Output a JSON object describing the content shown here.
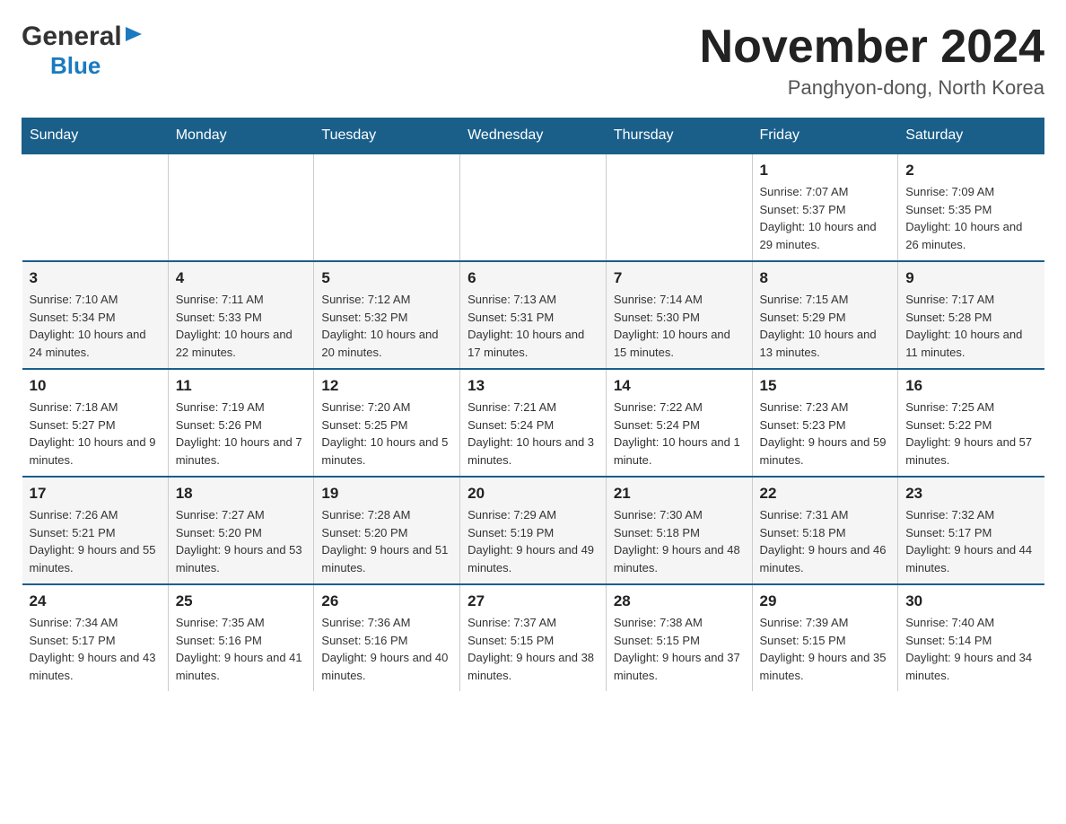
{
  "header": {
    "logo": {
      "general": "General",
      "blue": "Blue"
    },
    "title": "November 2024",
    "location": "Panghyon-dong, North Korea"
  },
  "days_of_week": [
    "Sunday",
    "Monday",
    "Tuesday",
    "Wednesday",
    "Thursday",
    "Friday",
    "Saturday"
  ],
  "weeks": [
    {
      "days": [
        {
          "number": "",
          "info": ""
        },
        {
          "number": "",
          "info": ""
        },
        {
          "number": "",
          "info": ""
        },
        {
          "number": "",
          "info": ""
        },
        {
          "number": "",
          "info": ""
        },
        {
          "number": "1",
          "info": "Sunrise: 7:07 AM\nSunset: 5:37 PM\nDaylight: 10 hours and 29 minutes."
        },
        {
          "number": "2",
          "info": "Sunrise: 7:09 AM\nSunset: 5:35 PM\nDaylight: 10 hours and 26 minutes."
        }
      ]
    },
    {
      "days": [
        {
          "number": "3",
          "info": "Sunrise: 7:10 AM\nSunset: 5:34 PM\nDaylight: 10 hours and 24 minutes."
        },
        {
          "number": "4",
          "info": "Sunrise: 7:11 AM\nSunset: 5:33 PM\nDaylight: 10 hours and 22 minutes."
        },
        {
          "number": "5",
          "info": "Sunrise: 7:12 AM\nSunset: 5:32 PM\nDaylight: 10 hours and 20 minutes."
        },
        {
          "number": "6",
          "info": "Sunrise: 7:13 AM\nSunset: 5:31 PM\nDaylight: 10 hours and 17 minutes."
        },
        {
          "number": "7",
          "info": "Sunrise: 7:14 AM\nSunset: 5:30 PM\nDaylight: 10 hours and 15 minutes."
        },
        {
          "number": "8",
          "info": "Sunrise: 7:15 AM\nSunset: 5:29 PM\nDaylight: 10 hours and 13 minutes."
        },
        {
          "number": "9",
          "info": "Sunrise: 7:17 AM\nSunset: 5:28 PM\nDaylight: 10 hours and 11 minutes."
        }
      ]
    },
    {
      "days": [
        {
          "number": "10",
          "info": "Sunrise: 7:18 AM\nSunset: 5:27 PM\nDaylight: 10 hours and 9 minutes."
        },
        {
          "number": "11",
          "info": "Sunrise: 7:19 AM\nSunset: 5:26 PM\nDaylight: 10 hours and 7 minutes."
        },
        {
          "number": "12",
          "info": "Sunrise: 7:20 AM\nSunset: 5:25 PM\nDaylight: 10 hours and 5 minutes."
        },
        {
          "number": "13",
          "info": "Sunrise: 7:21 AM\nSunset: 5:24 PM\nDaylight: 10 hours and 3 minutes."
        },
        {
          "number": "14",
          "info": "Sunrise: 7:22 AM\nSunset: 5:24 PM\nDaylight: 10 hours and 1 minute."
        },
        {
          "number": "15",
          "info": "Sunrise: 7:23 AM\nSunset: 5:23 PM\nDaylight: 9 hours and 59 minutes."
        },
        {
          "number": "16",
          "info": "Sunrise: 7:25 AM\nSunset: 5:22 PM\nDaylight: 9 hours and 57 minutes."
        }
      ]
    },
    {
      "days": [
        {
          "number": "17",
          "info": "Sunrise: 7:26 AM\nSunset: 5:21 PM\nDaylight: 9 hours and 55 minutes."
        },
        {
          "number": "18",
          "info": "Sunrise: 7:27 AM\nSunset: 5:20 PM\nDaylight: 9 hours and 53 minutes."
        },
        {
          "number": "19",
          "info": "Sunrise: 7:28 AM\nSunset: 5:20 PM\nDaylight: 9 hours and 51 minutes."
        },
        {
          "number": "20",
          "info": "Sunrise: 7:29 AM\nSunset: 5:19 PM\nDaylight: 9 hours and 49 minutes."
        },
        {
          "number": "21",
          "info": "Sunrise: 7:30 AM\nSunset: 5:18 PM\nDaylight: 9 hours and 48 minutes."
        },
        {
          "number": "22",
          "info": "Sunrise: 7:31 AM\nSunset: 5:18 PM\nDaylight: 9 hours and 46 minutes."
        },
        {
          "number": "23",
          "info": "Sunrise: 7:32 AM\nSunset: 5:17 PM\nDaylight: 9 hours and 44 minutes."
        }
      ]
    },
    {
      "days": [
        {
          "number": "24",
          "info": "Sunrise: 7:34 AM\nSunset: 5:17 PM\nDaylight: 9 hours and 43 minutes."
        },
        {
          "number": "25",
          "info": "Sunrise: 7:35 AM\nSunset: 5:16 PM\nDaylight: 9 hours and 41 minutes."
        },
        {
          "number": "26",
          "info": "Sunrise: 7:36 AM\nSunset: 5:16 PM\nDaylight: 9 hours and 40 minutes."
        },
        {
          "number": "27",
          "info": "Sunrise: 7:37 AM\nSunset: 5:15 PM\nDaylight: 9 hours and 38 minutes."
        },
        {
          "number": "28",
          "info": "Sunrise: 7:38 AM\nSunset: 5:15 PM\nDaylight: 9 hours and 37 minutes."
        },
        {
          "number": "29",
          "info": "Sunrise: 7:39 AM\nSunset: 5:15 PM\nDaylight: 9 hours and 35 minutes."
        },
        {
          "number": "30",
          "info": "Sunrise: 7:40 AM\nSunset: 5:14 PM\nDaylight: 9 hours and 34 minutes."
        }
      ]
    }
  ]
}
